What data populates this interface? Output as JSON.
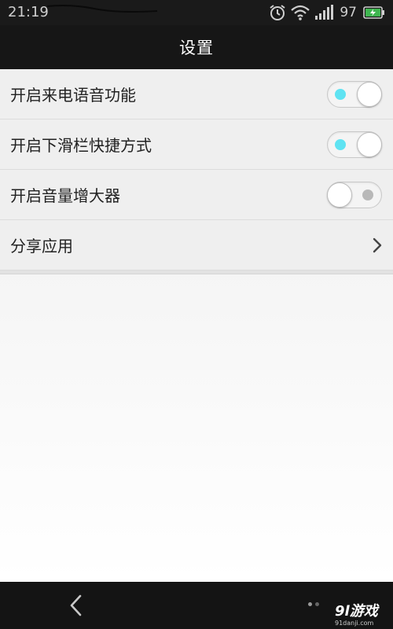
{
  "status_bar": {
    "time": "21:19",
    "battery_level": "97",
    "icons": [
      "alarm-icon",
      "wifi-icon",
      "signal-icon",
      "battery-charging-icon"
    ]
  },
  "header": {
    "title": "设置"
  },
  "settings": {
    "items": [
      {
        "label": "开启来电语音功能",
        "type": "toggle",
        "state": "on"
      },
      {
        "label": "开启下滑栏快捷方式",
        "type": "toggle",
        "state": "on"
      },
      {
        "label": "开启音量增大器",
        "type": "toggle",
        "state": "off"
      },
      {
        "label": "分享应用",
        "type": "link",
        "icon": "chevron-right-icon"
      }
    ]
  },
  "nav_bar": {
    "back_icon": "back-arrow-icon",
    "page_indicator": {
      "count": 2,
      "active": 1
    }
  },
  "watermark": {
    "logo": "9l游戏",
    "url": "91danji.com"
  },
  "colors": {
    "toggle_on_dot": "#5fe3f2",
    "toggle_off_dot": "#b8b8b8",
    "bar_background": "#161616"
  }
}
